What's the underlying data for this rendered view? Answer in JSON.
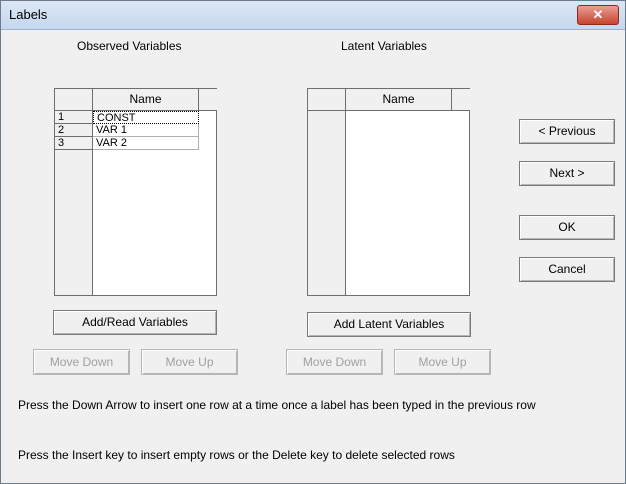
{
  "window": {
    "title": "Labels",
    "close_glyph": "✕"
  },
  "observed": {
    "heading": "Observed Variables",
    "column_header": "Name",
    "rows": [
      {
        "num": "1",
        "name": "CONST"
      },
      {
        "num": "2",
        "name": "VAR 1"
      },
      {
        "num": "3",
        "name": "VAR 2"
      }
    ],
    "add_button": "Add/Read Variables",
    "move_down": "Move Down",
    "move_up": "Move Up"
  },
  "latent": {
    "heading": "Latent Variables",
    "column_header": "Name",
    "add_button": "Add Latent Variables",
    "move_down": "Move Down",
    "move_up": "Move Up"
  },
  "buttons": {
    "previous": "< Previous",
    "next": "Next >",
    "ok": "OK",
    "cancel": "Cancel"
  },
  "instructions": {
    "line1": "Press the Down Arrow to insert one row at a time once a label has been typed in the previous row",
    "line2": "Press the Insert key to insert empty rows or the Delete key to delete selected rows"
  }
}
